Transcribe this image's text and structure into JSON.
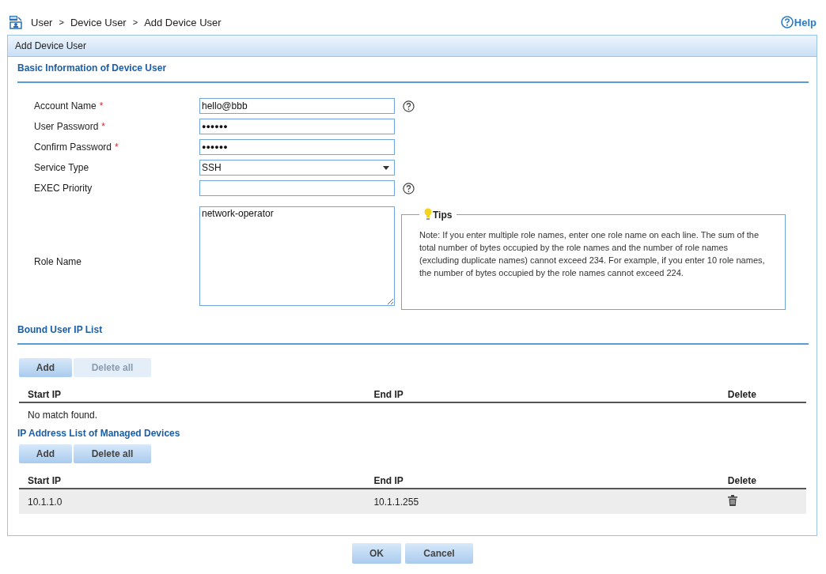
{
  "breadcrumb": {
    "items": [
      "User",
      "Device User",
      "Add Device User"
    ],
    "separator": ">"
  },
  "help_link": "Help",
  "panel": {
    "title": "Add Device User"
  },
  "basic_section": {
    "title": "Basic Information of Device User",
    "fields": [
      {
        "kind": "text",
        "label": "Account Name",
        "required_mark": "*",
        "value": "hello@bbb",
        "help": true
      },
      {
        "kind": "password",
        "label": "User Password",
        "required_mark": "*",
        "value": "●●●●●●",
        "help": false
      },
      {
        "kind": "password",
        "label": "Confirm Password",
        "required_mark": "*",
        "value": "●●●●●●",
        "help": false
      },
      {
        "kind": "select",
        "label": "Service Type",
        "value": "SSH",
        "help": false
      },
      {
        "kind": "text",
        "label": "EXEC Priority",
        "help": true
      },
      {
        "kind": "textarea",
        "label": "Role Name",
        "value": "network-operator",
        "help": false
      }
    ],
    "tips": {
      "title": "Tips",
      "text": "Note: If you enter multiple role names, enter one role name on each line. The sum of the total number of bytes occupied by the role names and the number of role names (excluding duplicate names) cannot exceed 234. For example, if you enter 10 role names, the number of bytes occupied by the role names cannot exceed 224."
    }
  },
  "lists": [
    {
      "title": "Bound User IP List",
      "divider": true,
      "buttons": [
        {
          "label": "Add",
          "disabled": false
        },
        {
          "label": "Delete all",
          "disabled": true
        }
      ],
      "columns": [
        "Start IP",
        "End IP",
        "Delete"
      ],
      "empty_message": "No match found."
    },
    {
      "title": "IP Address List of Managed Devices",
      "divider": false,
      "buttons": [
        {
          "label": "Add",
          "disabled": false
        },
        {
          "label": "Delete all",
          "disabled": false
        }
      ],
      "columns": [
        "Start IP",
        "End IP",
        "Delete"
      ],
      "rows": [
        {
          "start_ip": "10.1.1.0",
          "end_ip": "10.1.1.255"
        }
      ]
    }
  ],
  "footer_buttons": [
    "OK",
    "Cancel"
  ]
}
